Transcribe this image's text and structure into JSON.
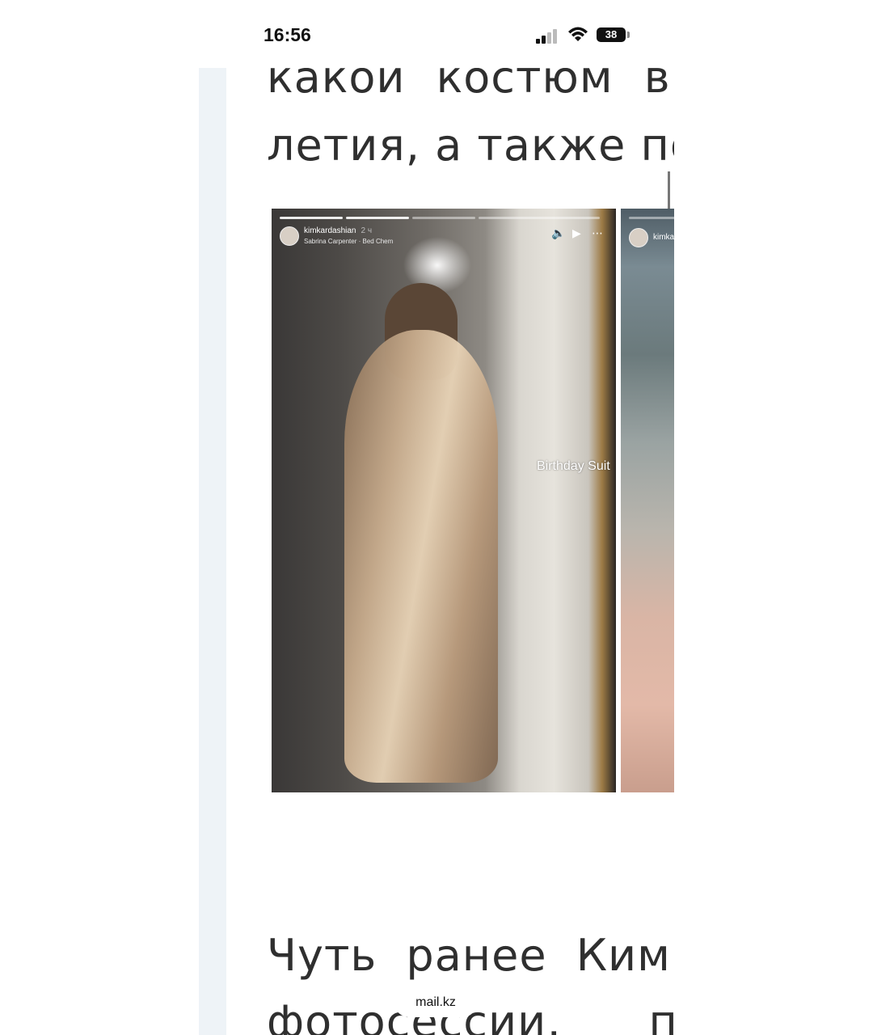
{
  "status_bar": {
    "time": "16:56",
    "battery": "38"
  },
  "article": {
    "lines_top": [
      "какой костюм выб",
      "летия, а также пок"
    ],
    "lines_bottom": [
      "Чуть ранее Ким о",
      "фотосессии, по"
    ]
  },
  "stories": [
    {
      "username": "kimkardashian",
      "time": "2 ч",
      "music": "Sabrina Carpenter · Bed Chem",
      "sticker_text": "Birthday Suit",
      "controls": [
        "mute-icon",
        "play-icon",
        "more-icon"
      ]
    },
    {
      "username": "kimka"
    }
  ],
  "source": {
    "domain": "mail.kz"
  }
}
